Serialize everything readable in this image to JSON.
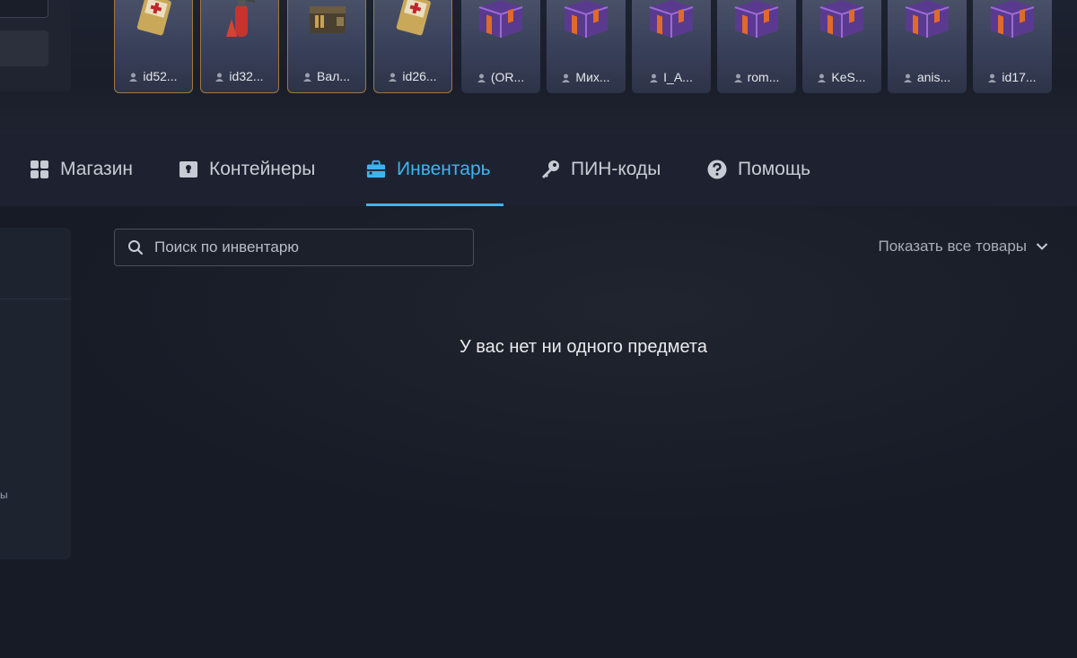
{
  "cards": [
    {
      "label": "id52...",
      "image": "first-aid-kit-icon",
      "gold": true
    },
    {
      "label": "id32...",
      "image": "fire-extinguisher-icon",
      "gold": true
    },
    {
      "label": "Вал...",
      "image": "ammo-box-icon",
      "gold": true
    },
    {
      "label": "id26...",
      "image": "first-aid-kit-icon",
      "gold": true
    },
    {
      "label": "(OR...",
      "image": "purple-crate-icon",
      "gold": false
    },
    {
      "label": "Мих...",
      "image": "purple-crate-icon",
      "gold": false
    },
    {
      "label": "I_A...",
      "image": "purple-crate-icon",
      "gold": false
    },
    {
      "label": "rom...",
      "image": "purple-crate-icon",
      "gold": false
    },
    {
      "label": "KeS...",
      "image": "purple-crate-icon",
      "gold": false
    },
    {
      "label": "anis...",
      "image": "purple-crate-icon",
      "gold": false
    },
    {
      "label": "id17...",
      "image": "purple-crate-icon",
      "gold": false
    }
  ],
  "nav": {
    "shop": "Магазин",
    "containers": "Контейнеры",
    "inventory": "Инвентарь",
    "pin_codes": "ПИН-коды",
    "help": "Помощь"
  },
  "search": {
    "placeholder": "Поиск по инвентарю"
  },
  "filter": {
    "label": "Показать все товары"
  },
  "empty_message": "У вас нет ни одного предмета",
  "left_fragment": "ы",
  "colors": {
    "accent": "#3fb3f0",
    "background": "#171b26",
    "nav_background": "#1e2230",
    "card_gold_border": "#a0783a"
  }
}
